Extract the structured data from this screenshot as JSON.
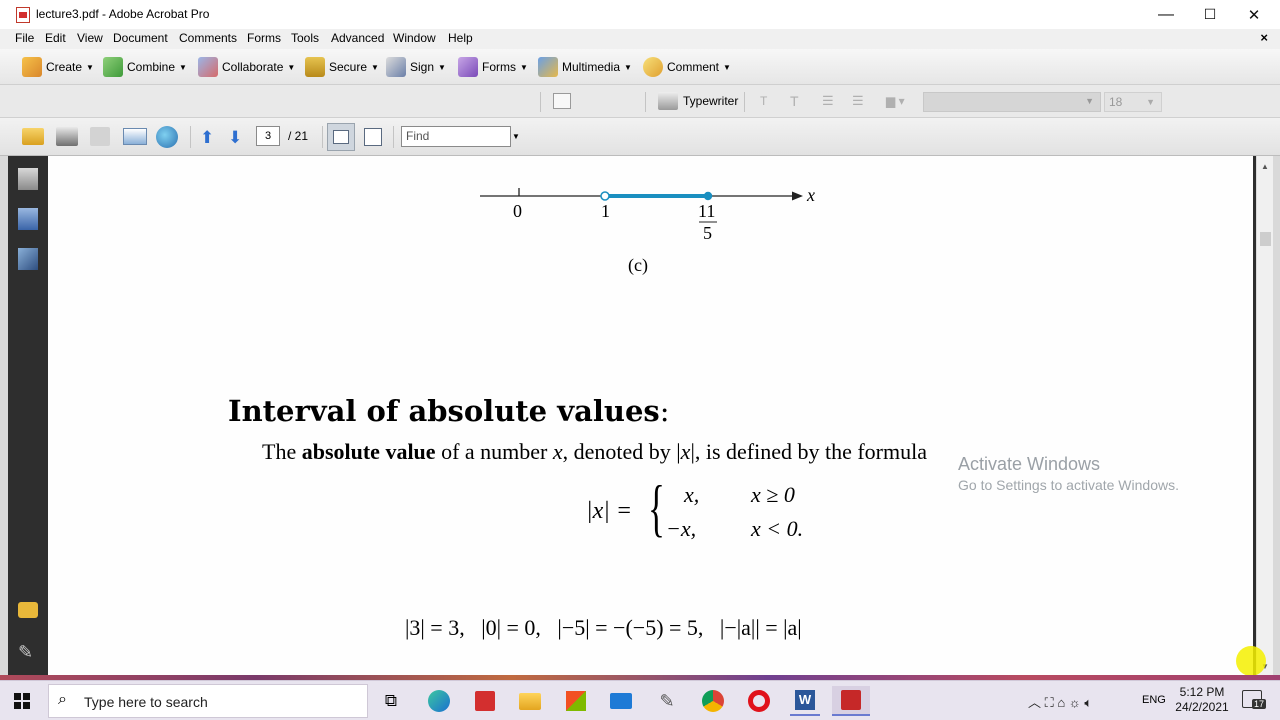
{
  "window": {
    "title": "lecture3.pdf - Adobe Acrobat Pro",
    "minimize": "—",
    "maximize": "☐",
    "close": "✕"
  },
  "menu": {
    "items": [
      "File",
      "Edit",
      "View",
      "Document",
      "Comments",
      "Forms",
      "Tools",
      "Advanced",
      "Window",
      "Help"
    ],
    "doc_close": "×"
  },
  "toolbar": {
    "create": "Create",
    "combine": "Combine",
    "collaborate": "Collaborate",
    "secure": "Secure",
    "sign": "Sign",
    "forms": "Forms",
    "multimedia": "Multimedia",
    "comment": "Comment",
    "typewriter": "Typewriter",
    "font_size": "18"
  },
  "nav": {
    "page": "3",
    "total": "/ 21",
    "find_placeholder": "Find"
  },
  "document": {
    "number_line": {
      "ticks": [
        "0",
        "1"
      ],
      "frac_num": "11",
      "frac_den": "5",
      "axis_var": "x",
      "caption": "(c)"
    },
    "heading": "Interval of absolute values",
    "heading_colon": ":",
    "definition": {
      "the": "The ",
      "term": "absolute value",
      "mid": " of a number ",
      "x": "x",
      "denoted": ", denoted by |",
      "x2": "x",
      "rest": "|, is defined by the formula"
    },
    "formula": {
      "lhs": "|x| =",
      "case1_val": "x,",
      "case1_cond": "x ≥ 0",
      "case2_val": "−x,",
      "case2_cond": "x < 0."
    },
    "examples": "|3| = 3,   |0| = 0,   |−5| = −(−5) = 5,   |−|a|| = |a|"
  },
  "watermark": {
    "title": "Activate Windows",
    "sub": "Go to Settings to activate Windows."
  },
  "taskbar": {
    "search_placeholder": "Type here to search",
    "lang": "ENG",
    "time": "5:12 PM",
    "date": "24/2/2021",
    "notifications": "17"
  }
}
